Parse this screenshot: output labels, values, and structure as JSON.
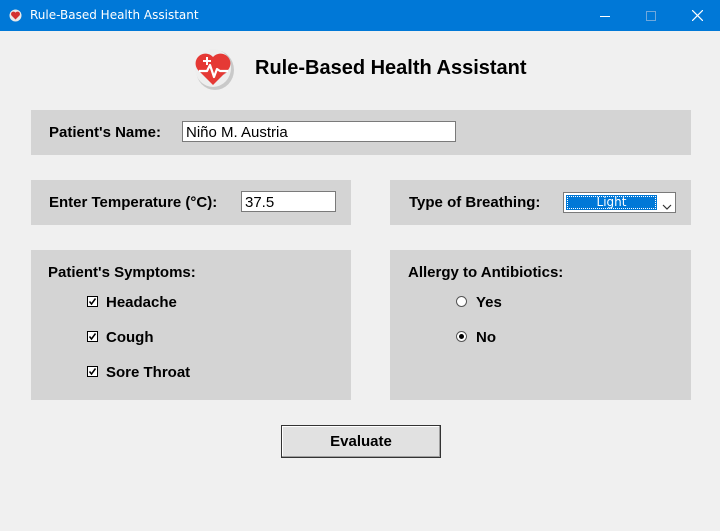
{
  "window": {
    "title": "Rule-Based Health Assistant",
    "accent_color": "#0078d7",
    "controls": [
      "minimize-icon",
      "maximize-icon",
      "close-icon"
    ]
  },
  "header": {
    "title": "Rule-Based Health Assistant",
    "icon": "heart-pulse-icon"
  },
  "patient": {
    "name_label": "Patient's Name:",
    "name_value": "Niño M. Austria"
  },
  "temperature": {
    "label": "Enter Temperature (°C):",
    "value": "37.5"
  },
  "breathing": {
    "label": "Type of Breathing:",
    "selected": "Light"
  },
  "symptoms": {
    "label": "Patient's Symptoms:",
    "items": [
      {
        "label": "Headache",
        "checked": true
      },
      {
        "label": "Cough",
        "checked": true
      },
      {
        "label": "Sore Throat",
        "checked": true
      }
    ]
  },
  "allergy": {
    "label": "Allergy to Antibiotics:",
    "options": [
      {
        "label": "Yes",
        "selected": false
      },
      {
        "label": "No",
        "selected": true
      }
    ]
  },
  "actions": {
    "evaluate_label": "Evaluate"
  }
}
